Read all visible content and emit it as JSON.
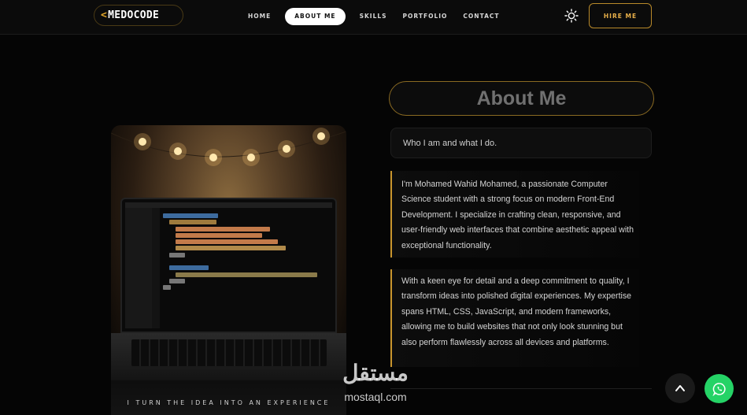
{
  "header": {
    "logo_bracket": "<",
    "logo_text": "MEDOCODE",
    "nav": [
      "HOME",
      "ABOUT ME",
      "SKILLS",
      "PORTFOLIO",
      "CONTACT"
    ],
    "active_nav": "ABOUT ME",
    "theme_icon": "sun-icon",
    "hire_label": "HIRE ME",
    "accent_color": "#e0a52b"
  },
  "image_card": {
    "tagline": "I TURN THE IDEA INTO AN EXPERIENCE",
    "image_subject": "laptop-with-code-editor-under-string-lights"
  },
  "about": {
    "title": "About Me",
    "subtitle": "Who I am and what I do.",
    "paragraph1": "I'm Mohamed Wahid Mohamed, a passionate Computer Science student with a strong focus on modern Front-End Development. I specialize in crafting clean, responsive, and user-friendly web interfaces that combine aesthetic appeal with exceptional functionality.",
    "paragraph2": "With a keen eye for detail and a deep commitment to quality, I transform ideas into polished digital experiences. My expertise spans HTML, CSS, JavaScript, and modern frameworks, allowing me to build websites that not only look stunning but also perform flawlessly across all devices and platforms."
  },
  "watermark": {
    "arabic": "مستقل",
    "latin": "mostaql.com"
  },
  "floating": {
    "scroll_top_icon": "chevron-up-icon",
    "whatsapp_icon": "whatsapp-icon",
    "whatsapp_color": "#25d366"
  }
}
